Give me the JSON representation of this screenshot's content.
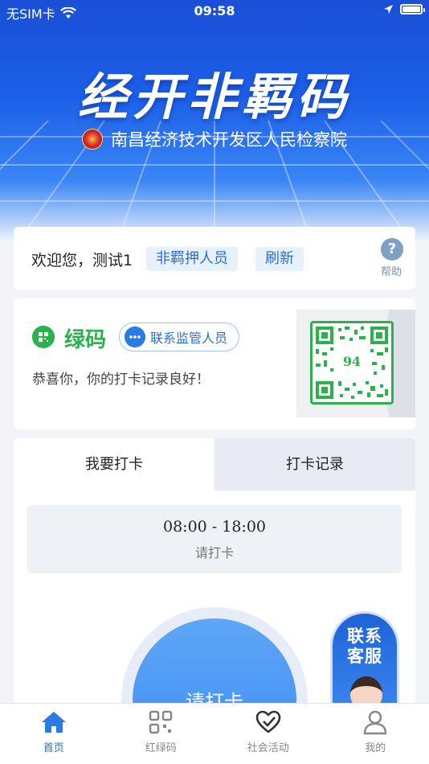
{
  "status_bar": {
    "carrier": "无SIM卡",
    "time": "09:58"
  },
  "banner": {
    "title": "经开非羁码",
    "subtitle": "南昌经济技术开发区人民检察院"
  },
  "welcome": {
    "text": "欢迎您，测试1",
    "role_tag": "非羁押人员",
    "refresh_label": "刷新",
    "help_label": "帮助"
  },
  "code": {
    "status": "绿码",
    "status_color": "#2bb24c",
    "contact_label": "联系监管人员",
    "message": "恭喜你，你的打卡记录良好！",
    "qr_number": "94"
  },
  "punch": {
    "tabs": [
      "我要打卡",
      "打卡记录"
    ],
    "time_range": "08:00 - 18:00",
    "time_hint": "请打卡",
    "button_label": "请打卡"
  },
  "customer_service": {
    "line1": "联系",
    "line2": "客服"
  },
  "tabbar": {
    "items": [
      {
        "label": "首页",
        "icon": "home-icon"
      },
      {
        "label": "红绿码",
        "icon": "code-grid-icon"
      },
      {
        "label": "社会活动",
        "icon": "heart-check-icon"
      },
      {
        "label": "我的",
        "icon": "user-icon"
      }
    ],
    "active_color": "#2a6fd0"
  }
}
